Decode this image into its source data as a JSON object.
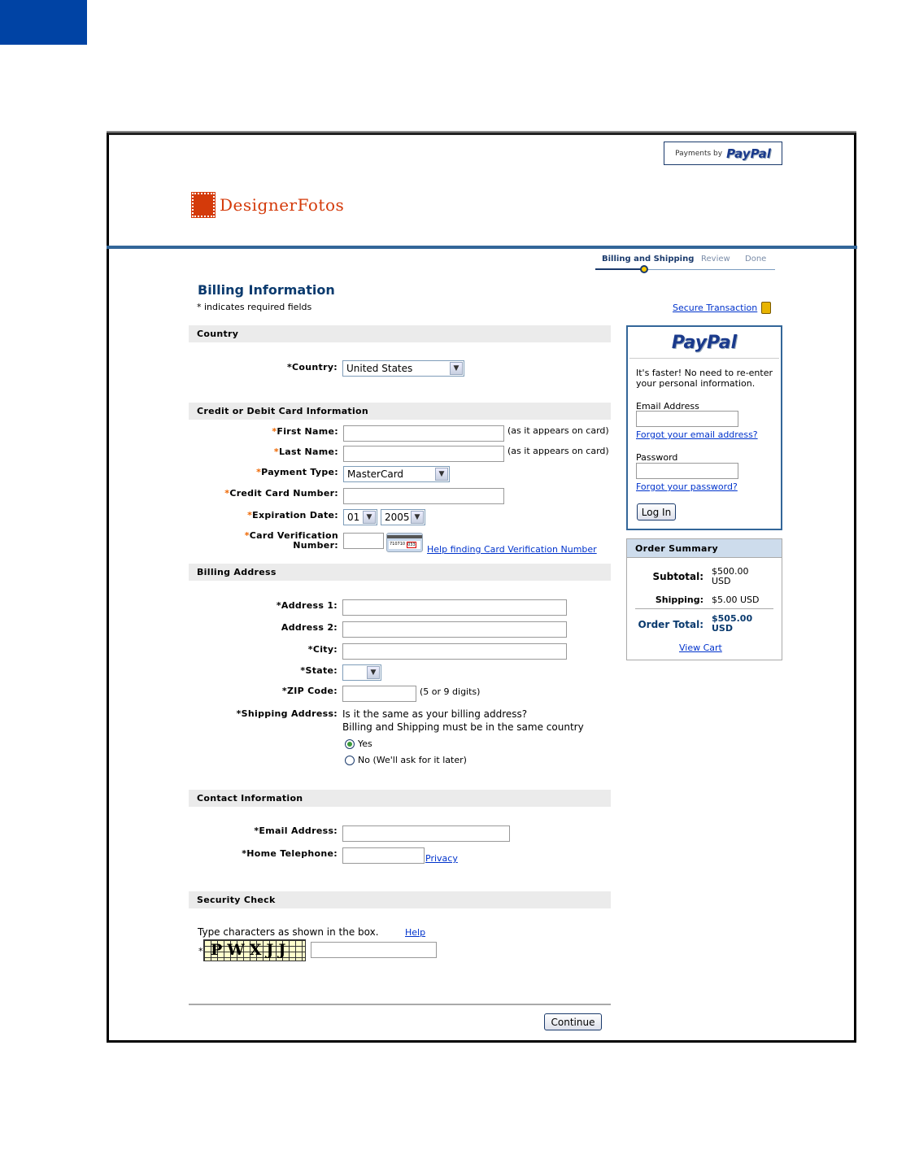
{
  "header": {
    "payments_by": "Payments by",
    "paypal_brand": "PayPal",
    "merchant_logo_text": "DesignerFotos"
  },
  "colors": {
    "accent": "#336699",
    "heading": "#0a3a6e",
    "required_star": "#ee6600",
    "merchant_brand": "#d43a0a"
  },
  "progress": {
    "steps": [
      "Billing and Shipping",
      "Review",
      "Done"
    ],
    "current_step": 0
  },
  "page": {
    "title": "Billing Information",
    "required_note": "* indicates required fields",
    "secure_link": "Secure Transaction"
  },
  "country": {
    "section_title": "Country",
    "label": "Country:",
    "value": "United States"
  },
  "card": {
    "section_title": "Credit or Debit Card Information",
    "first_name_label": "First Name:",
    "last_name_label": "Last Name:",
    "as_on_card": "(as it appears on card)",
    "payment_type_label": "Payment Type:",
    "payment_type_value": "MasterCard",
    "number_label": "Credit Card Number:",
    "expiration_label": "Expiration Date:",
    "exp_month": "01",
    "exp_year": "2005",
    "cvv_label_1": "Card Verification",
    "cvv_label_2": "Number:",
    "cvv_image_digits": "710710",
    "cvv_image_code": "033",
    "cvv_help": "Help finding Card Verification Number"
  },
  "billing": {
    "section_title": "Billing Address",
    "address1_label": "Address 1:",
    "address2_label": "Address 2:",
    "city_label": "City:",
    "state_label": "State:",
    "zip_label": "ZIP Code:",
    "zip_note": "(5 or 9 digits)",
    "shipping_label": "Shipping Address:",
    "shipping_question": "Is it the same as your billing address?",
    "shipping_note": "Billing and Shipping must be in the same country",
    "option_yes": "Yes",
    "option_no": "No (We'll ask for it later)",
    "selected": "Yes"
  },
  "contact": {
    "section_title": "Contact Information",
    "email_label": "Email Address:",
    "phone_label": "Home Telephone:",
    "privacy_link": "Privacy"
  },
  "security": {
    "section_title": "Security Check",
    "instruction": "Type characters as shown in the box.",
    "help_link": "Help",
    "captcha_text": "PWXJJ"
  },
  "continue_label": "Continue",
  "login": {
    "brand": "PayPal",
    "intro": "It's faster! No need to re-enter your personal information.",
    "email_label": "Email Address",
    "forgot_email": "Forgot your email address?",
    "password_label": "Password",
    "forgot_password": "Forgot your password?",
    "login_button": "Log In"
  },
  "order_summary": {
    "title": "Order Summary",
    "subtotal_label": "Subtotal:",
    "subtotal_value": "$500.00 USD",
    "shipping_label": "Shipping:",
    "shipping_value": "$5.00 USD",
    "total_label": "Order Total:",
    "total_value": "$505.00 USD",
    "view_cart": "View Cart"
  },
  "required_mark": "*"
}
